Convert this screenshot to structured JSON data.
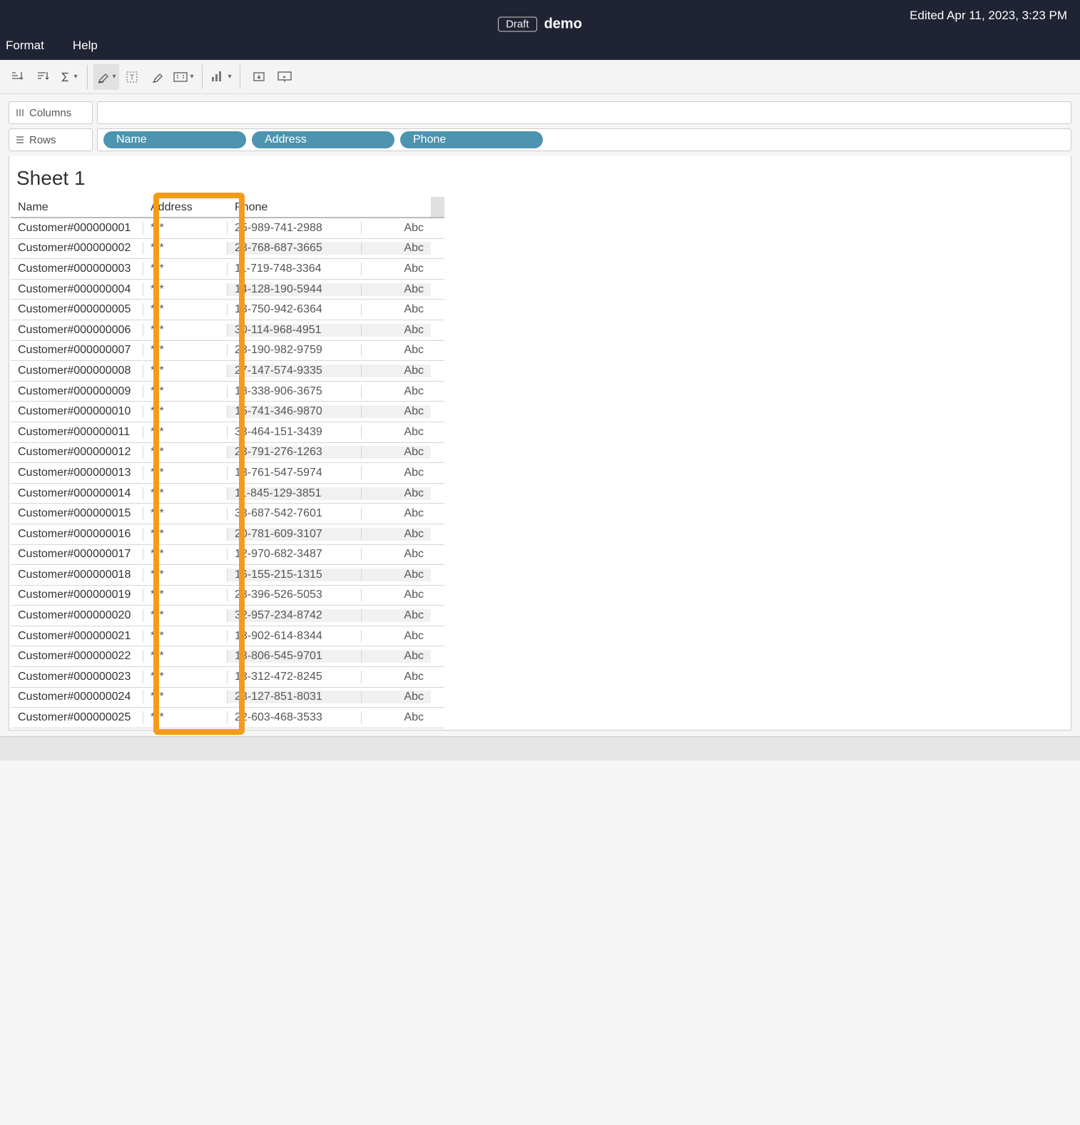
{
  "header": {
    "draft_label": "Draft",
    "title": "demo",
    "edited_text": "Edited Apr 11, 2023, 3:23 PM",
    "menu": {
      "format": "Format",
      "help": "Help"
    }
  },
  "toolbar": {
    "icons": {
      "sort_asc": "sort-asc-icon",
      "sort_desc": "sort-desc-icon",
      "sigma": "sigma-icon",
      "highlight": "highlight-icon",
      "text": "text-icon",
      "format_paint": "format-paint-icon",
      "fit": "fit-icon",
      "show_me": "show-me-icon",
      "download": "download-icon",
      "present": "present-icon"
    }
  },
  "shelves": {
    "columns_label": "Columns",
    "rows_label": "Rows",
    "pills": {
      "name": "Name",
      "address": "Address",
      "phone": "Phone"
    }
  },
  "worksheet": {
    "title": "Sheet 1",
    "headers": {
      "name": "Name",
      "address": "Address",
      "phone": "Phone"
    },
    "abc_marker": "Abc",
    "rows": [
      {
        "name": "Customer#000000001",
        "address": "***",
        "phone": "25-989-741-2988"
      },
      {
        "name": "Customer#000000002",
        "address": "***",
        "phone": "23-768-687-3665"
      },
      {
        "name": "Customer#000000003",
        "address": "***",
        "phone": "11-719-748-3364"
      },
      {
        "name": "Customer#000000004",
        "address": "***",
        "phone": "14-128-190-5944"
      },
      {
        "name": "Customer#000000005",
        "address": "***",
        "phone": "13-750-942-6364"
      },
      {
        "name": "Customer#000000006",
        "address": "***",
        "phone": "30-114-968-4951"
      },
      {
        "name": "Customer#000000007",
        "address": "***",
        "phone": "28-190-982-9759"
      },
      {
        "name": "Customer#000000008",
        "address": "***",
        "phone": "27-147-574-9335"
      },
      {
        "name": "Customer#000000009",
        "address": "***",
        "phone": "18-338-906-3675"
      },
      {
        "name": "Customer#000000010",
        "address": "***",
        "phone": "15-741-346-9870"
      },
      {
        "name": "Customer#000000011",
        "address": "***",
        "phone": "33-464-151-3439"
      },
      {
        "name": "Customer#000000012",
        "address": "***",
        "phone": "23-791-276-1263"
      },
      {
        "name": "Customer#000000013",
        "address": "***",
        "phone": "13-761-547-5974"
      },
      {
        "name": "Customer#000000014",
        "address": "***",
        "phone": "11-845-129-3851"
      },
      {
        "name": "Customer#000000015",
        "address": "***",
        "phone": "33-687-542-7601"
      },
      {
        "name": "Customer#000000016",
        "address": "***",
        "phone": "20-781-609-3107"
      },
      {
        "name": "Customer#000000017",
        "address": "***",
        "phone": "12-970-682-3487"
      },
      {
        "name": "Customer#000000018",
        "address": "***",
        "phone": "16-155-215-1315"
      },
      {
        "name": "Customer#000000019",
        "address": "***",
        "phone": "28-396-526-5053"
      },
      {
        "name": "Customer#000000020",
        "address": "***",
        "phone": "32-957-234-8742"
      },
      {
        "name": "Customer#000000021",
        "address": "***",
        "phone": "18-902-614-8344"
      },
      {
        "name": "Customer#000000022",
        "address": "***",
        "phone": "13-806-545-9701"
      },
      {
        "name": "Customer#000000023",
        "address": "***",
        "phone": "13-312-472-8245"
      },
      {
        "name": "Customer#000000024",
        "address": "***",
        "phone": "23-127-851-8031"
      },
      {
        "name": "Customer#000000025",
        "address": "***",
        "phone": "22-603-468-3533"
      }
    ]
  },
  "annotation": {
    "highlight_column": "address"
  }
}
